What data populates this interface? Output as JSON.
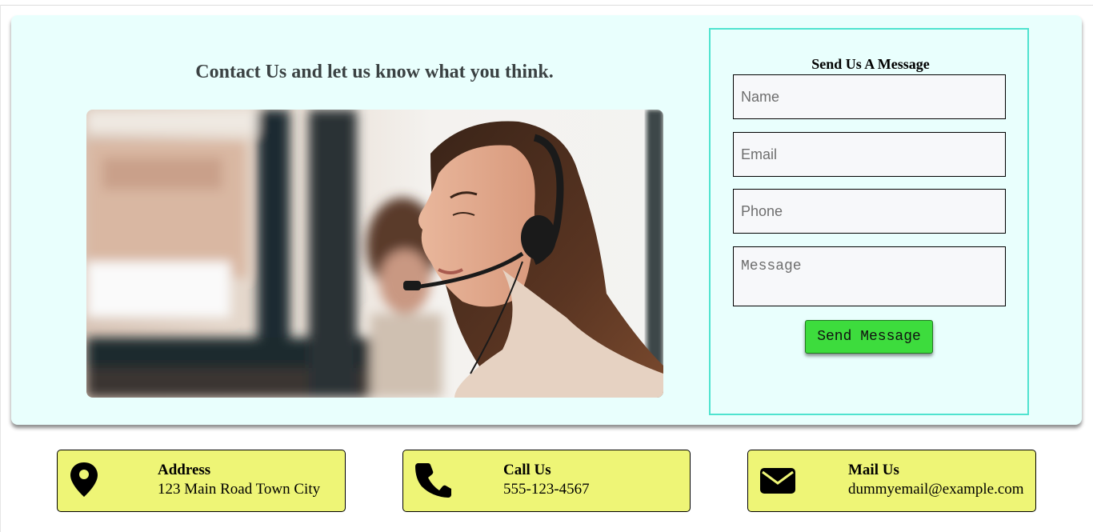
{
  "contact": {
    "heading": "Contact Us and let us know what you think.",
    "photo_alt": "Customer support agent wearing a headset"
  },
  "form": {
    "title": "Send Us A Message",
    "name_placeholder": "Name",
    "email_placeholder": "Email",
    "phone_placeholder": "Phone",
    "message_placeholder": "Message",
    "submit_label": "Send Message",
    "accent_color": "#4fe3cf",
    "button_color": "#3ddc3d"
  },
  "info_cards": {
    "address": {
      "icon": "location-pin-icon",
      "title": "Address",
      "text": "123 Main Road Town City"
    },
    "phone": {
      "icon": "phone-icon",
      "title": "Call Us",
      "text": "555-123-4567"
    },
    "mail": {
      "icon": "envelope-icon",
      "title": "Mail Us",
      "text": "dummyemail@example.com"
    },
    "card_color": "#eef576"
  }
}
